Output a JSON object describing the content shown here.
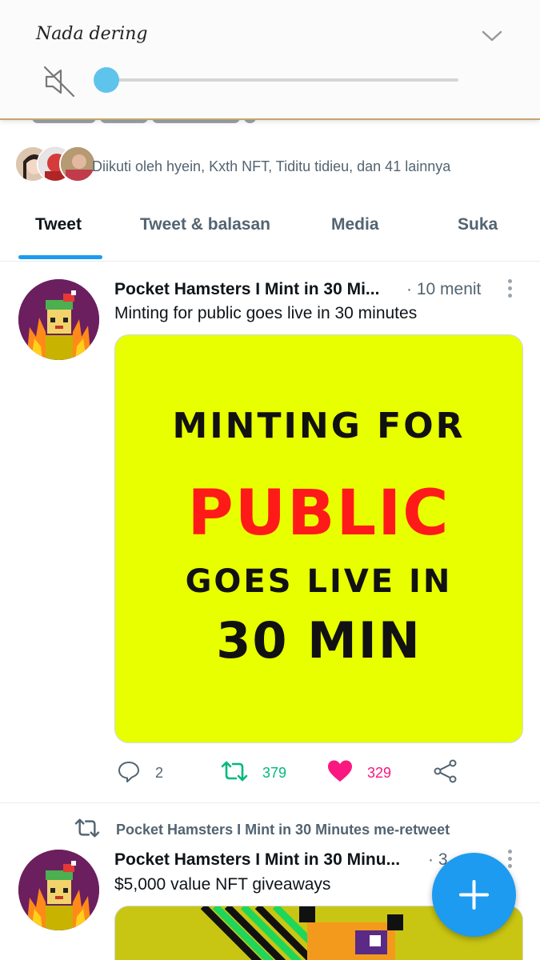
{
  "volume_panel": {
    "title": "Nada dering",
    "level_fraction": 0.0
  },
  "profile": {
    "followed_by_text": "Diikuti oleh hyein, Kxth NFT, Tiditu tidieu, dan 41 lainnya"
  },
  "tabs": [
    {
      "label": "Tweet",
      "active": true
    },
    {
      "label": "Tweet & balasan",
      "active": false
    },
    {
      "label": "Media",
      "active": false
    },
    {
      "label": "Suka",
      "active": false
    }
  ],
  "tweets": [
    {
      "author": "Pocket Hamsters I Mint in 30 Mi...",
      "time": "· 10 menit",
      "text": "Minting for public goes live in 30 minutes",
      "media_lines": [
        "MINTING FOR",
        "PUBLIC",
        "GOES LIVE IN",
        "30 MIN"
      ],
      "replies": "2",
      "retweets": "379",
      "likes": "329",
      "liked": true,
      "retweeted": true
    },
    {
      "retweeted_by": "Pocket Hamsters I Mint in 30 Minutes me-retweet",
      "author": "Pocket Hamsters I Mint in 30 Minu...",
      "time": "· 3",
      "text": "$5,000 value NFT giveaways"
    }
  ],
  "colors": {
    "accent": "#1d9bf0",
    "retweet_green": "#00ba7c",
    "like_pink": "#f91880",
    "media_yellow": "#e8ff00",
    "media_red": "#ff1a1a"
  },
  "icons": {
    "fab": "plus-icon",
    "mute": "speaker-muted-icon",
    "collapse": "chevron-down-icon"
  }
}
